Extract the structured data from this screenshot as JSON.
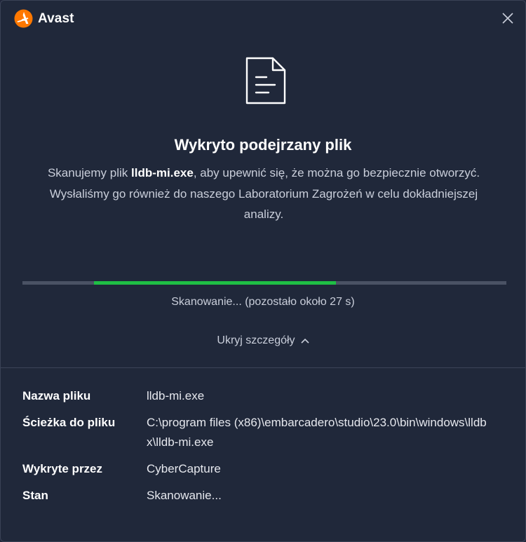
{
  "app": {
    "name": "Avast",
    "brand_color": "#ff7800"
  },
  "title": "Wykryto podejrzany plik",
  "description": {
    "line1_prefix": "Skanujemy plik ",
    "file_name": "lldb-mi.exe",
    "line1_suffix": ", aby upewnić się, że można go bezpiecznie otworzyć.",
    "line2": "Wysłaliśmy go również do naszego Laboratorium Zagrożeń w celu dokładniejszej analizy."
  },
  "progress": {
    "fraction": 0.5,
    "color": "#1fbf45",
    "label": "Skanowanie... (pozostało około 27 s)"
  },
  "toggle_label": "Ukryj szczegóły",
  "details": [
    {
      "key": "Nazwa pliku",
      "value": "lldb-mi.exe"
    },
    {
      "key": "Ścieżka do pliku",
      "value": "C:\\program files (x86)\\embarcadero\\studio\\23.0\\bin\\windows\\lldbx\\lldb-mi.exe"
    },
    {
      "key": "Wykryte przez",
      "value": "CyberCapture"
    },
    {
      "key": "Stan",
      "value": "Skanowanie..."
    }
  ],
  "icons": {
    "logo": "avast-logo-icon",
    "close": "close-icon",
    "file": "file-document-icon",
    "chevron": "chevron-up-icon"
  }
}
